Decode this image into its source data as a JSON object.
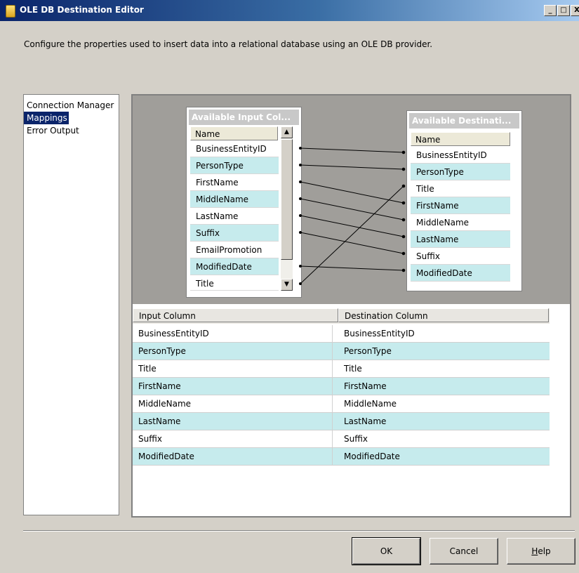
{
  "window": {
    "title": "OLE DB Destination Editor",
    "controls": [
      "_",
      "□",
      "X"
    ]
  },
  "description": "Configure the properties used to insert data into a relational database using an OLE DB provider.",
  "nav": {
    "items": [
      {
        "label": "Connection Manager",
        "selected": false
      },
      {
        "label": "Mappings",
        "selected": true
      },
      {
        "label": "Error Output",
        "selected": false
      }
    ]
  },
  "input_box": {
    "title": "Available Input Col...",
    "header": "Name",
    "rows": [
      "BusinessEntityID",
      "PersonType",
      "FirstName",
      "MiddleName",
      "LastName",
      "Suffix",
      "EmailPromotion",
      "ModifiedDate",
      "Title"
    ]
  },
  "dest_box": {
    "title": "Available Destinati...",
    "header": "Name",
    "rows": [
      "BusinessEntityID",
      "PersonType",
      "Title",
      "FirstName",
      "MiddleName",
      "LastName",
      "Suffix",
      "ModifiedDate"
    ]
  },
  "grid": {
    "headers": [
      "Input Column",
      "Destination Column"
    ],
    "rows": [
      [
        "BusinessEntityID",
        "BusinessEntityID"
      ],
      [
        "PersonType",
        "PersonType"
      ],
      [
        "Title",
        "Title"
      ],
      [
        "FirstName",
        "FirstName"
      ],
      [
        "MiddleName",
        "MiddleName"
      ],
      [
        "LastName",
        "LastName"
      ],
      [
        "Suffix",
        "Suffix"
      ],
      [
        "ModifiedDate",
        "ModifiedDate"
      ]
    ]
  },
  "buttons": {
    "ok": "OK",
    "cancel": "Cancel",
    "help_mnemonic": "H",
    "help_rest": "elp"
  },
  "colors": {
    "title_gradient_start": "#0a246a",
    "selected_nav": "#0a246a",
    "alt_row": "#c6ebed",
    "mapping_background": "#a09e9a"
  },
  "icons": [
    "database-destination-icon",
    "minimize-icon",
    "maximize-icon",
    "close-icon",
    "scroll-up-icon",
    "scroll-down-icon"
  ]
}
